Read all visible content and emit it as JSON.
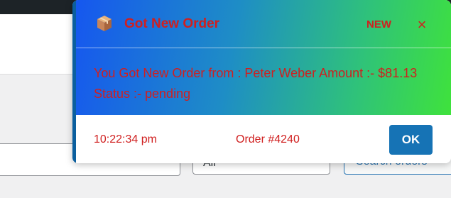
{
  "background": {
    "select_value": "All",
    "button_label": "Search orders"
  },
  "notification": {
    "title": "Got New Order",
    "badge": "NEW",
    "close_symbol": "×",
    "message": "You Got New Order from : Peter Weber Amount :- $81.13 Status :- pending",
    "time": "10:22:34 pm",
    "order_label": "Order #4240",
    "ok_label": "OK",
    "icon": "package-box-icon",
    "colors": {
      "text_accent": "#d01f1f",
      "gradient_start": "#1656f0",
      "gradient_end": "#3fe23c",
      "ok_button": "#1673b5"
    }
  }
}
